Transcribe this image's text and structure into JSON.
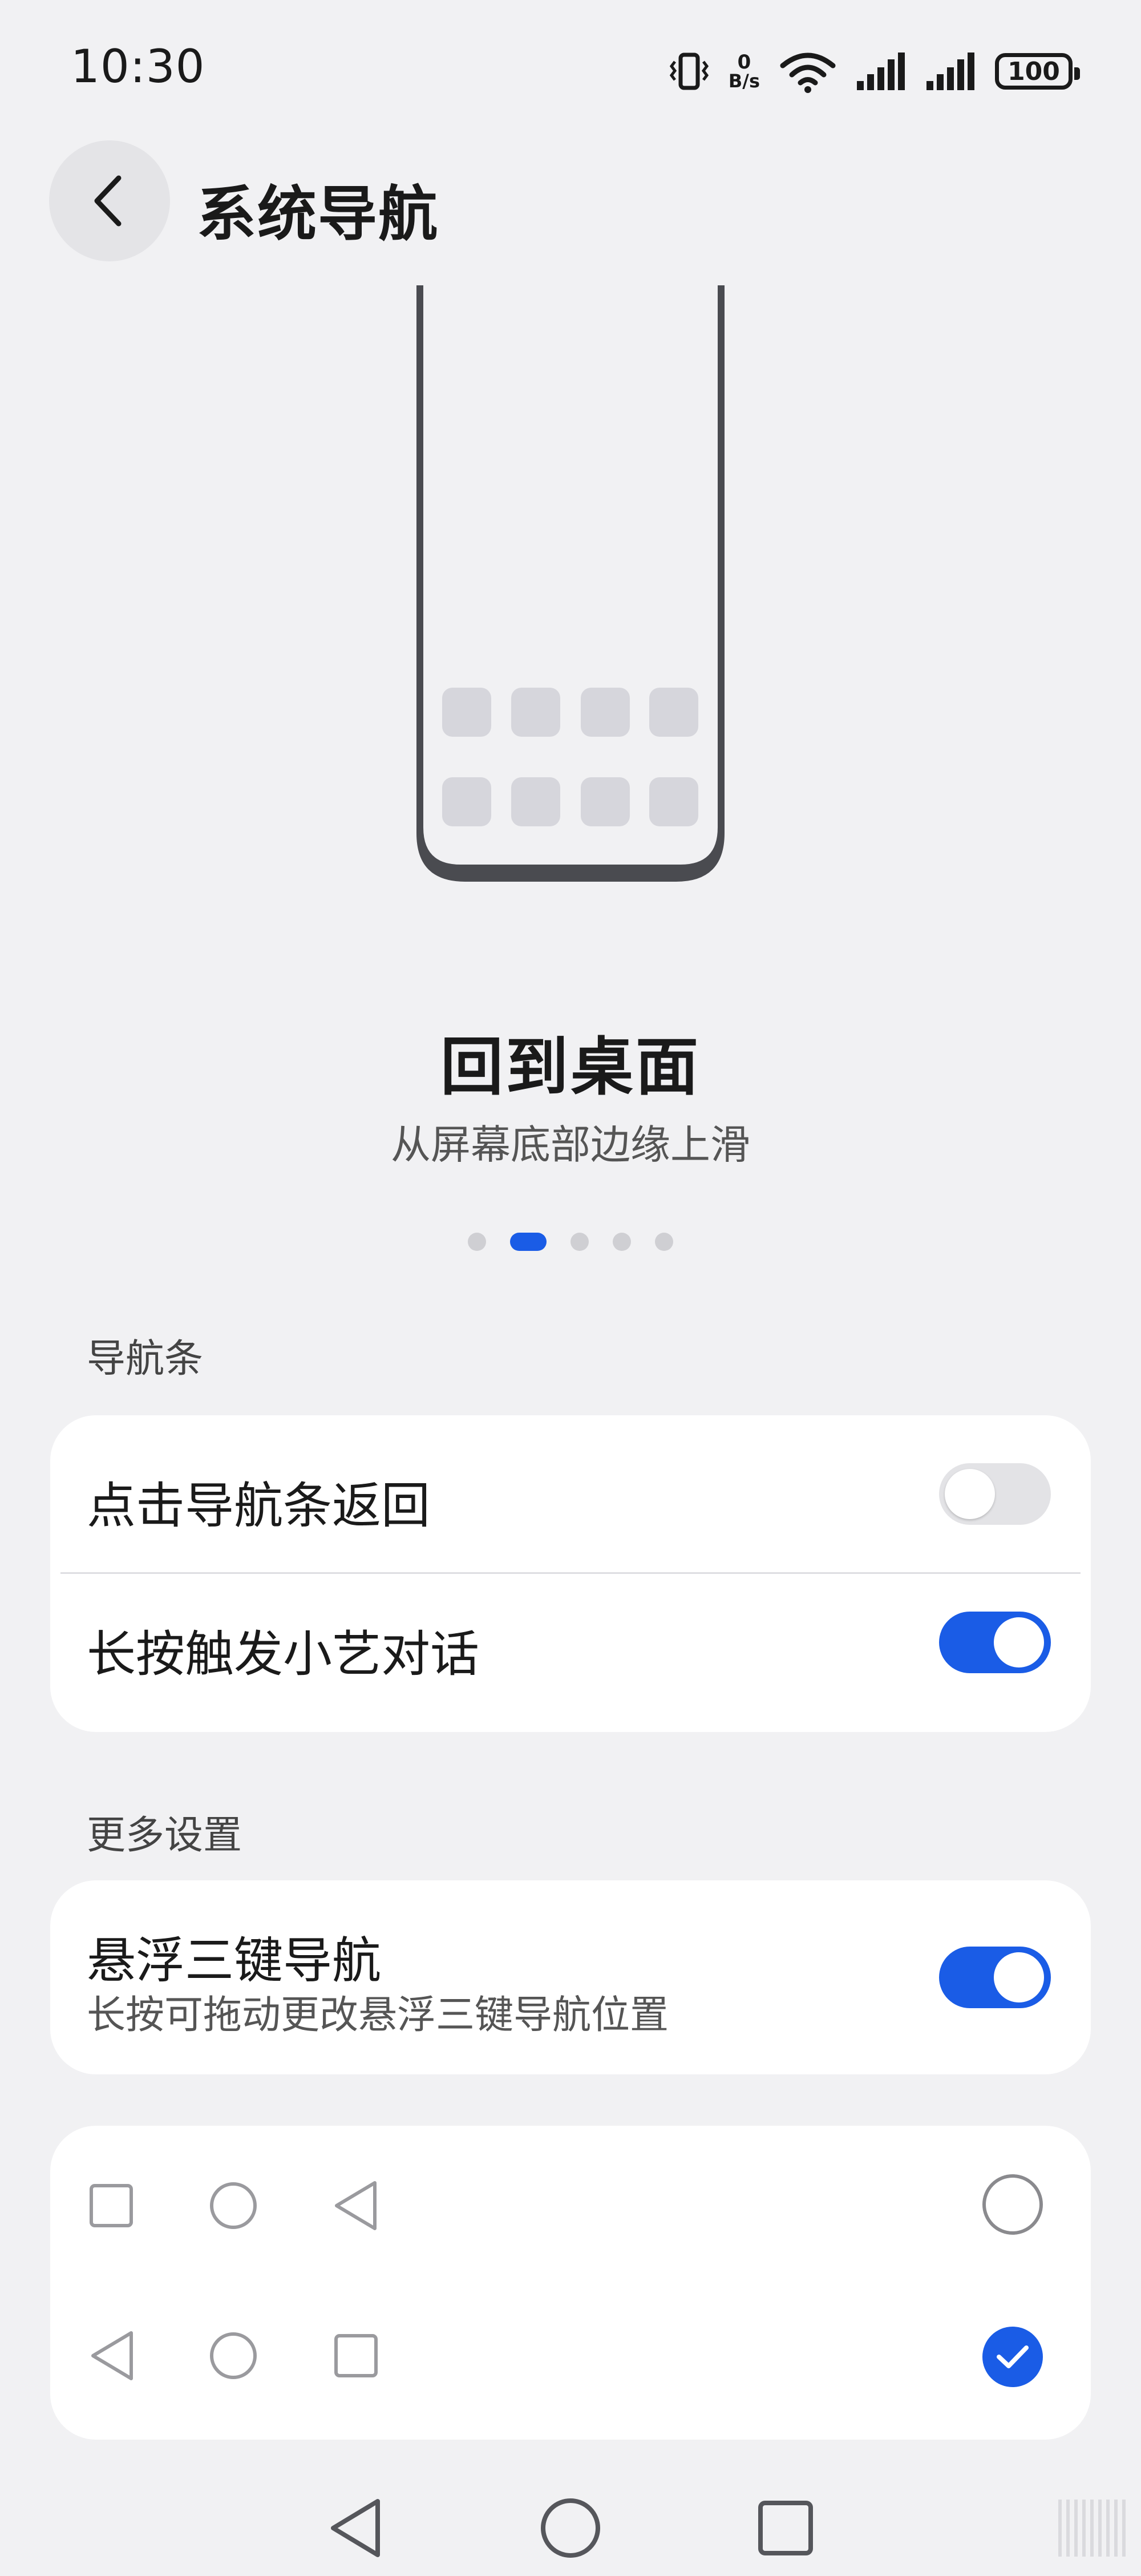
{
  "status_bar": {
    "time": "10:30",
    "net_speed_value": "0",
    "net_speed_unit": "B/s",
    "battery_level": "100",
    "icons": [
      "vibrate-icon",
      "net-speed-icon",
      "wifi-icon",
      "signal-icon",
      "signal-icon",
      "battery-icon"
    ]
  },
  "header": {
    "back_icon": "chevron-left-icon",
    "title": "系统导航"
  },
  "animation": {
    "title": "回到桌面",
    "subtitle": "从屏幕底部边缘上滑",
    "page_count": 5,
    "active_page": 2
  },
  "nav_bar_section": {
    "label": "导航条",
    "items": [
      {
        "label": "点击导航条返回",
        "enabled": false
      },
      {
        "label": "长按触发小艺对话",
        "enabled": true
      }
    ]
  },
  "more_section": {
    "label": "更多设置",
    "floating_nav": {
      "title": "悬浮三键导航",
      "subtitle": "长按可拖动更改悬浮三键导航位置",
      "enabled": true
    }
  },
  "layout_options": [
    {
      "icons": [
        "square-icon",
        "circle-icon",
        "triangle-left-icon"
      ],
      "selected": false
    },
    {
      "icons": [
        "triangle-left-icon",
        "circle-icon",
        "square-icon"
      ],
      "selected": true
    }
  ],
  "system_nav": {
    "icons": [
      "back-triangle-icon",
      "home-circle-icon",
      "recents-square-icon"
    ]
  },
  "colors": {
    "accent": "#1a5ce6",
    "background": "#f1f1f3",
    "card": "#ffffff"
  }
}
